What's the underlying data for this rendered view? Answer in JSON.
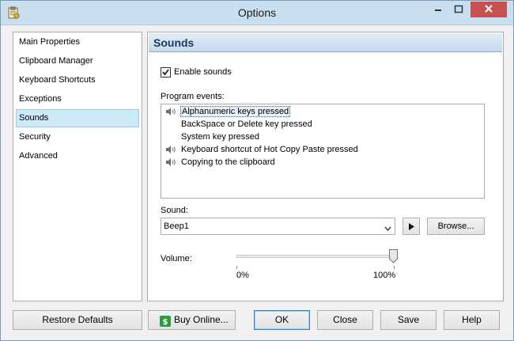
{
  "window": {
    "title": "Options",
    "accent_color": "#c9dff0",
    "close_color": "#c75050"
  },
  "sidebar": {
    "items": [
      {
        "label": "Main Properties"
      },
      {
        "label": "Clipboard Manager"
      },
      {
        "label": "Keyboard Shortcuts"
      },
      {
        "label": "Exceptions"
      },
      {
        "label": "Sounds",
        "selected": true
      },
      {
        "label": "Security"
      },
      {
        "label": "Advanced"
      }
    ]
  },
  "panel": {
    "title": "Sounds",
    "enable_sounds": {
      "label": "Enable sounds",
      "checked": true
    },
    "events_label": "Program events:",
    "events": [
      {
        "label": "Alphanumeric keys pressed",
        "has_sound": true,
        "focused": true
      },
      {
        "label": "BackSpace or Delete key pressed",
        "has_sound": false
      },
      {
        "label": "System key pressed",
        "has_sound": false
      },
      {
        "label": "Keyboard shortcut of Hot Copy Paste pressed",
        "has_sound": true
      },
      {
        "label": "Copying to the clipboard",
        "has_sound": true
      }
    ],
    "sound_label": "Sound:",
    "sound_value": "Beep1",
    "browse_label": "Browse...",
    "volume_label": "Volume:",
    "volume_min": "0%",
    "volume_max": "100%",
    "volume_level": 1.0
  },
  "footer": {
    "restore_label": "Restore Defaults",
    "buy_label": "Buy Online...",
    "ok_label": "OK",
    "close_label": "Close",
    "save_label": "Save",
    "help_label": "Help"
  },
  "icons": {
    "app": "clipboard-icon",
    "speaker": "speaker-icon",
    "play": "play-icon",
    "buy": "dollar-icon"
  }
}
